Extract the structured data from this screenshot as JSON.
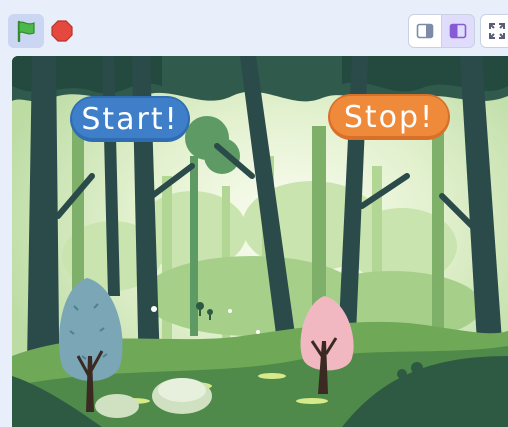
{
  "toolbar": {
    "green_flag_icon": "green-flag-icon",
    "stop_icon": "stop-sign-icon",
    "small_stage_icon": "small-stage-icon",
    "normal_stage_icon": "normal-stage-icon",
    "fullscreen_icon": "fullscreen-icon"
  },
  "stage": {
    "backdrop": "forest",
    "start_button": {
      "label": "Start!",
      "color": "#3f7fc9"
    },
    "stop_button": {
      "label": "Stop!",
      "color": "#ef8a3a"
    }
  },
  "colors": {
    "toolbar_bg": "#e9effa",
    "flag_green": "#4cb84a",
    "stop_red": "#e5483f",
    "selected_mode": "#855cd6"
  }
}
